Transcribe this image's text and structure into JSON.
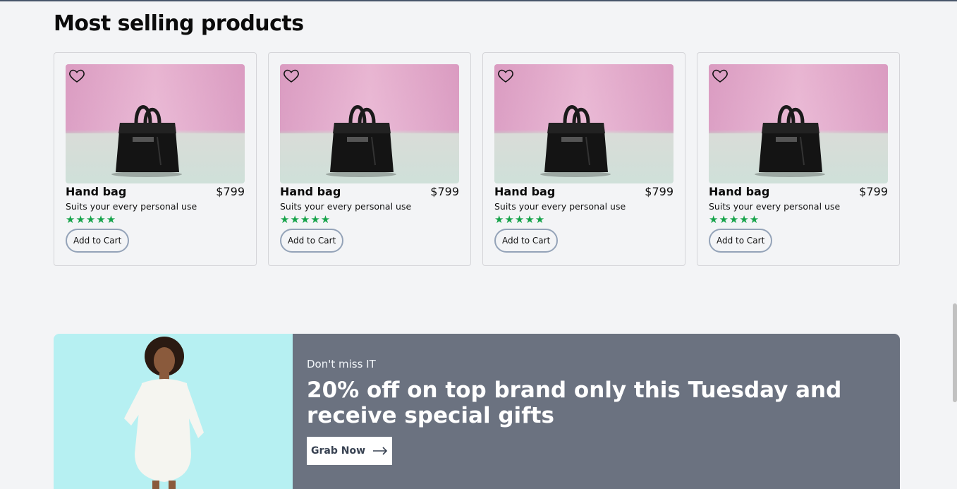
{
  "section": {
    "title": "Most selling products"
  },
  "products": [
    {
      "name": "Hand bag",
      "price": "$799",
      "description": "Suits your every personal use",
      "rating_stars": "★★★★★",
      "rating": 5,
      "cart_label": "Add to Cart"
    },
    {
      "name": "Hand bag",
      "price": "$799",
      "description": "Suits your every personal use",
      "rating_stars": "★★★★★",
      "rating": 5,
      "cart_label": "Add to Cart"
    },
    {
      "name": "Hand bag",
      "price": "$799",
      "description": "Suits your every personal use",
      "rating_stars": "★★★★★",
      "rating": 5,
      "cart_label": "Add to Cart"
    },
    {
      "name": "Hand bag",
      "price": "$799",
      "description": "Suits your every personal use",
      "rating_stars": "★★★★★",
      "rating": 5,
      "cart_label": "Add to Cart"
    }
  ],
  "banner": {
    "eyebrow": "Don't miss IT",
    "headline": "20% off on top brand only this Tuesday and receive special gifts",
    "cta_label": "Grab Now",
    "cta_icon": "arrow-right-icon"
  },
  "colors": {
    "background": "#f3f4f6",
    "star": "#16a34a",
    "banner_bg": "#6b7280",
    "banner_image_bg": "#b6f0f2"
  }
}
